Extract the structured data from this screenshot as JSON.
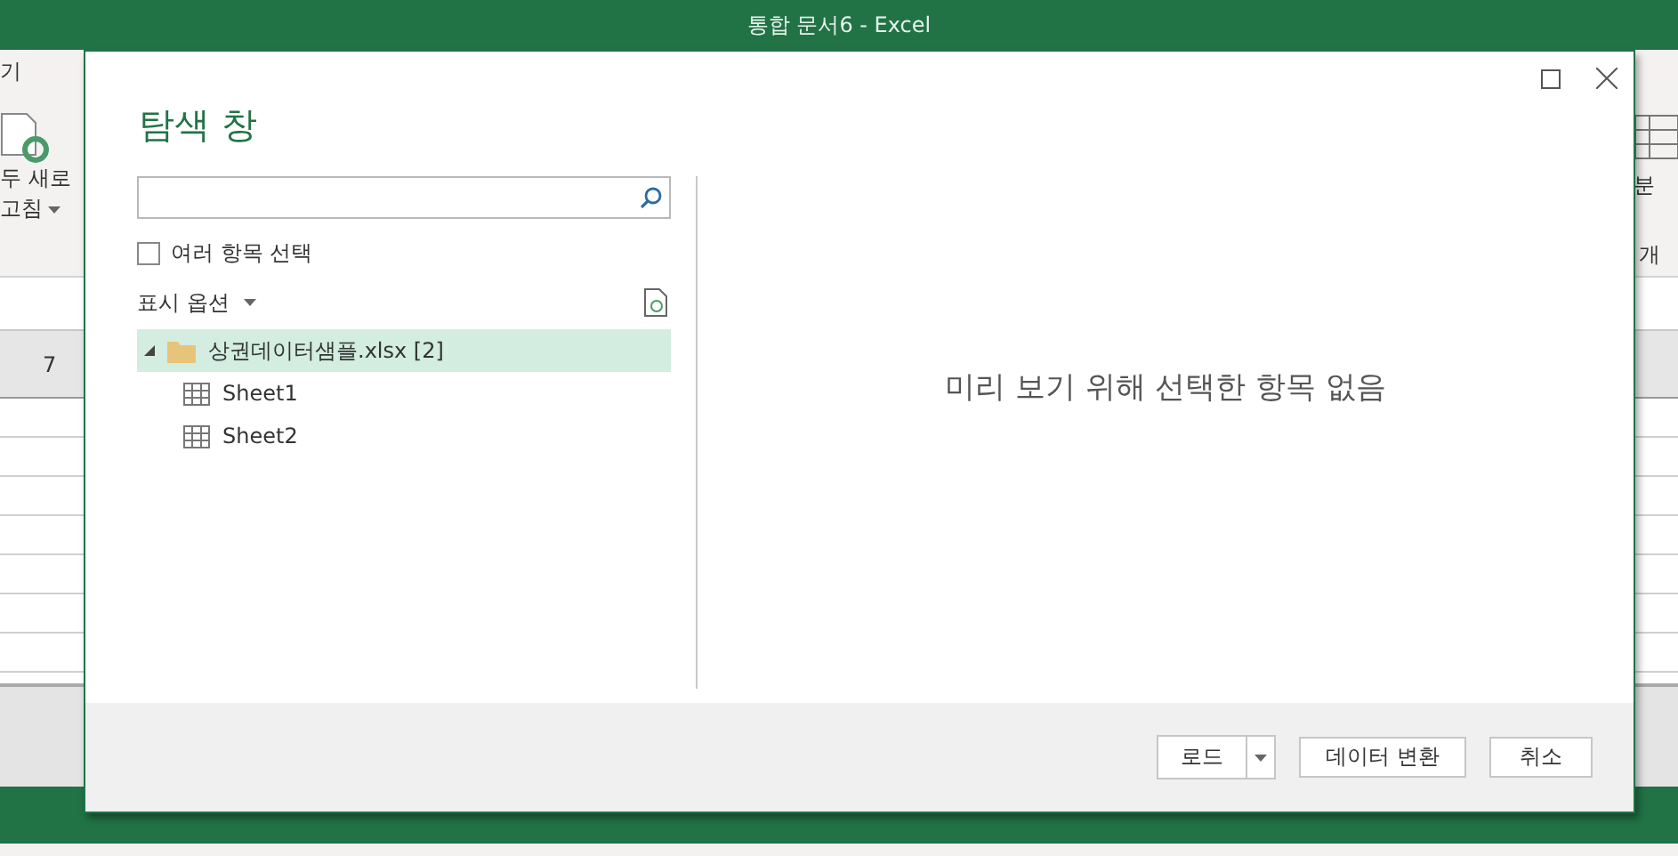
{
  "app_window": {
    "title": "통합 문서6 - Excel",
    "ribbon_tabs": [
      "기"
    ],
    "ribbon_left": {
      "button_label_lines": [
        "두 새로",
        "고침"
      ]
    },
    "ribbon_right": {
      "button_label": "분",
      "group_label": "개"
    },
    "column_header": "7"
  },
  "dialog": {
    "title": "탐색 창",
    "multi_select": {
      "label": "여러 항목 선택",
      "checked": false
    },
    "display_options": {
      "label": "표시 옵션"
    },
    "tree": [
      {
        "label": "상권데이터샘플.xlsx [2]",
        "kind": "folder",
        "selected": true,
        "expanded": true,
        "children": [
          {
            "label": "Sheet1",
            "kind": "sheet",
            "selected": false
          },
          {
            "label": "Sheet2",
            "kind": "sheet",
            "selected": false
          }
        ]
      }
    ],
    "preview_message": "미리 보기 위해 선택한 항목 없음",
    "buttons": [
      {
        "label": "로드",
        "kind": "split"
      },
      {
        "label": "데이터 변환",
        "kind": "plain"
      },
      {
        "label": "취소",
        "kind": "plain"
      }
    ]
  }
}
